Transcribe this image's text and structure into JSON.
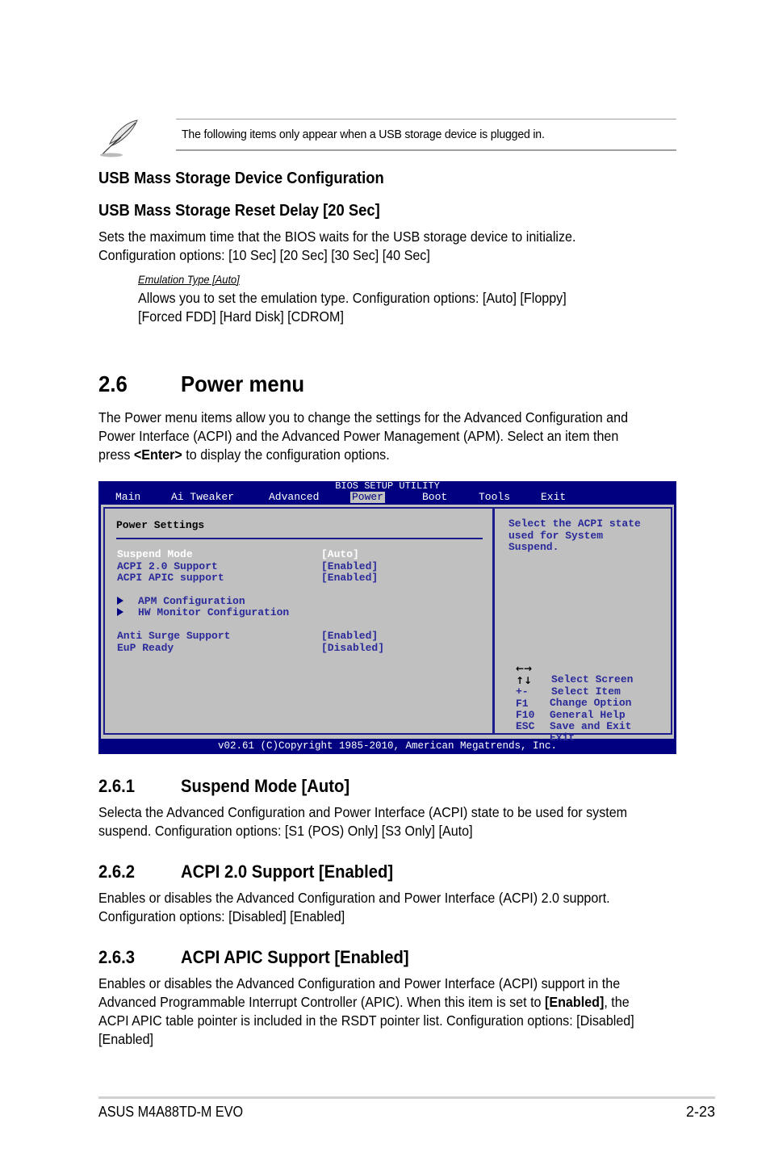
{
  "note": {
    "icon": "quill-pen-icon",
    "text": "The following items only appear when a USB storage device is plugged in."
  },
  "usb": {
    "heading1": "USB Mass Storage Device Configuration",
    "heading2": "USB Mass Storage Reset Delay [20 Sec]",
    "para_lines": [
      "Sets the maximum time that the BIOS waits for the USB storage device to initialize.",
      "Configuration options: [10 Sec] [20 Sec] [30 Sec] [40 Sec]"
    ],
    "sub_heading": "Emulation Type [Auto]",
    "sub_lines": [
      "Allows you to set the emulation type. Configuration options: [Auto] [Floppy]",
      "[Forced FDD] [Hard Disk] [CDROM]"
    ]
  },
  "section": {
    "number": "2.6",
    "title": "Power menu",
    "intro_lines": [
      "The Power menu items allow you to change the settings for the Advanced Configuration and",
      "Power Interface (ACPI) and the Advanced Power Management (APM). Select an item then"
    ],
    "intro_last_pre": "press ",
    "intro_last_bold": "<Enter>",
    "intro_last_post": " to display the configuration options."
  },
  "bios": {
    "title": "BIOS SETUP UTILITY",
    "menu": [
      "Main",
      "Ai Tweaker",
      "Advanced",
      "Power",
      "Boot",
      "Tools",
      "Exit"
    ],
    "active_menu": "Power",
    "panel_heading": "Power Settings",
    "items": [
      {
        "label": "Suspend Mode",
        "value": "[Auto]",
        "selected": true
      },
      {
        "label": "ACPI 2.0 Support",
        "value": "[Enabled]"
      },
      {
        "label": "ACPI APIC support",
        "value": "[Enabled]"
      },
      {
        "label": "APM Configuration",
        "submenu": true
      },
      {
        "label": "HW Monitor Configuration",
        "submenu": true
      },
      {
        "label": "Anti Surge Support",
        "value": "[Enabled]"
      },
      {
        "label": "EuP Ready",
        "value": "[Disabled]"
      }
    ],
    "help_lines": [
      "Select the ACPI state",
      "used for System",
      "Suspend."
    ],
    "keys": [
      {
        "key": "←→",
        "desc": "Select Screen"
      },
      {
        "key": "↑↓",
        "desc": "Select Item"
      },
      {
        "key": "+-",
        "desc": "Change Option"
      },
      {
        "key": "F1",
        "desc": "General Help"
      },
      {
        "key": "F10",
        "desc": "Save and Exit"
      },
      {
        "key": "ESC",
        "desc": "Exit"
      }
    ],
    "footer": "v02.61 (C)Copyright 1985-2010, American Megatrends, Inc.",
    "colors": {
      "frame": "#000080",
      "panel": "#c0c0c0",
      "text": "#2a2a9a",
      "selected": "#ffffff"
    }
  },
  "subsections": [
    {
      "number": "2.6.1",
      "title": "Suspend Mode [Auto]",
      "lines": [
        "Selecta the Advanced Configuration and Power Interface (ACPI) state to be used for system",
        "suspend. Configuration options: [S1 (POS) Only] [S3 Only] [Auto]"
      ]
    },
    {
      "number": "2.6.2",
      "title": "ACPI 2.0 Support [Enabled]",
      "lines": [
        "Enables or disables the Advanced Configuration and Power Interface (ACPI) 2.0 support.",
        "Configuration options: [Disabled] [Enabled]"
      ]
    },
    {
      "number": "2.6.3",
      "title": "ACPI APIC Support [Enabled]",
      "line1": "Enables or disables the Advanced Configuration and Power Interface (ACPI) support in the",
      "line2_pre": "Advanced Programmable Interrupt Controller (APIC). When this item is set to ",
      "line2_bold": "[Enabled]",
      "line2_post": ", the",
      "line3": "ACPI APIC table pointer is included in the RSDT pointer list. Configuration options: [Disabled]",
      "line4": "[Enabled]"
    }
  ],
  "footer": {
    "product": "ASUS M4A88TD-M EVO",
    "page": "2-23"
  }
}
